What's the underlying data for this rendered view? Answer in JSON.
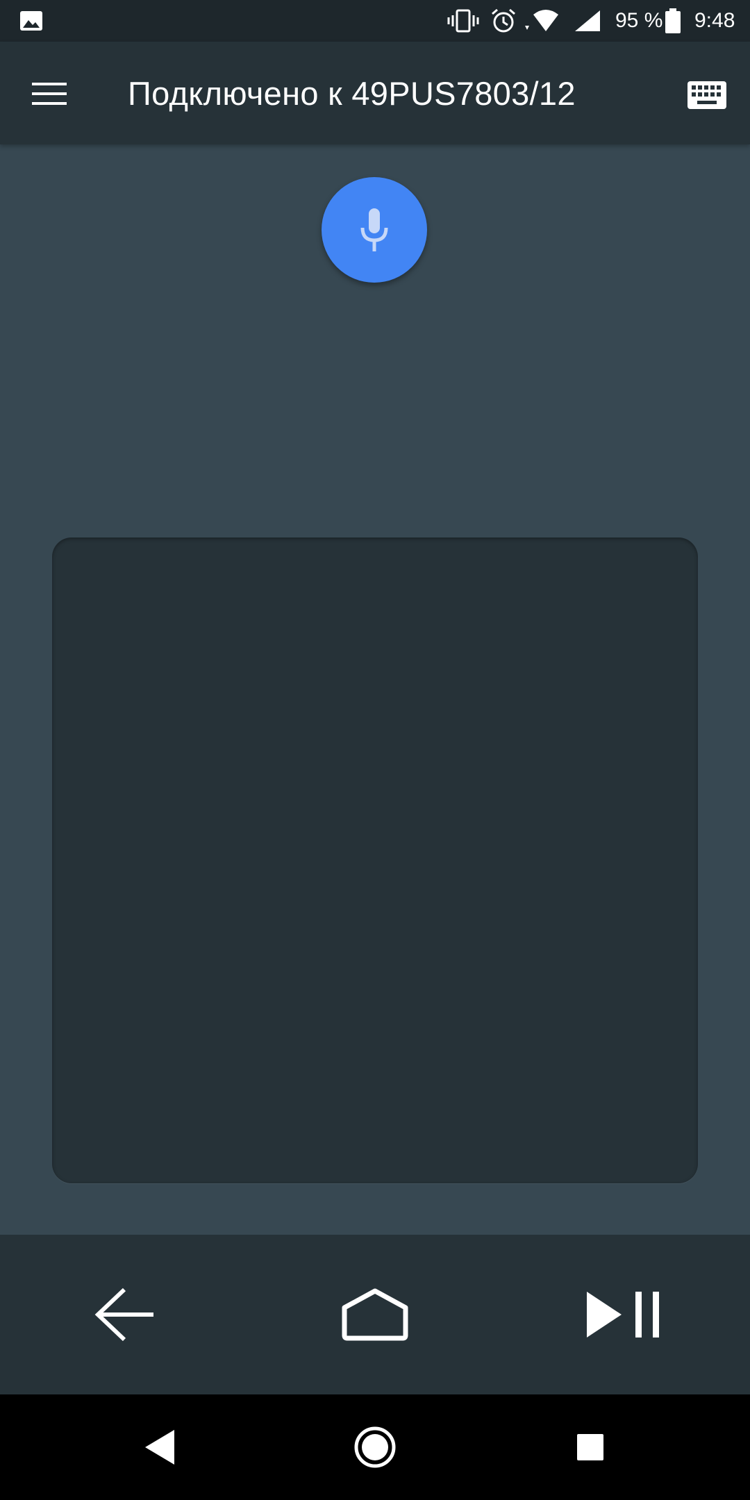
{
  "status_bar": {
    "battery_percent": "95 %",
    "time": "9:48",
    "icons": [
      "gallery-icon",
      "vibrate-icon",
      "alarm-icon",
      "wifi-icon",
      "signal-icon",
      "battery-icon"
    ]
  },
  "app_bar": {
    "title": "Подключено к 49PUS7803/12",
    "left_icon": "menu-icon",
    "right_icon": "keyboard-icon"
  },
  "voice": {
    "icon": "microphone-icon",
    "color": "#4285f4"
  },
  "touchpad": {
    "surface": "touchpad"
  },
  "controls": {
    "icons": [
      "back-arrow-icon",
      "home-icon",
      "play-pause-icon"
    ]
  },
  "system_nav": {
    "icons": [
      "nav-back-icon",
      "nav-home-icon",
      "nav-recents-icon"
    ]
  },
  "colors": {
    "background": "#374852",
    "app_bar": "#263238",
    "status_bar": "#1e272c",
    "accent": "#4285f4"
  }
}
